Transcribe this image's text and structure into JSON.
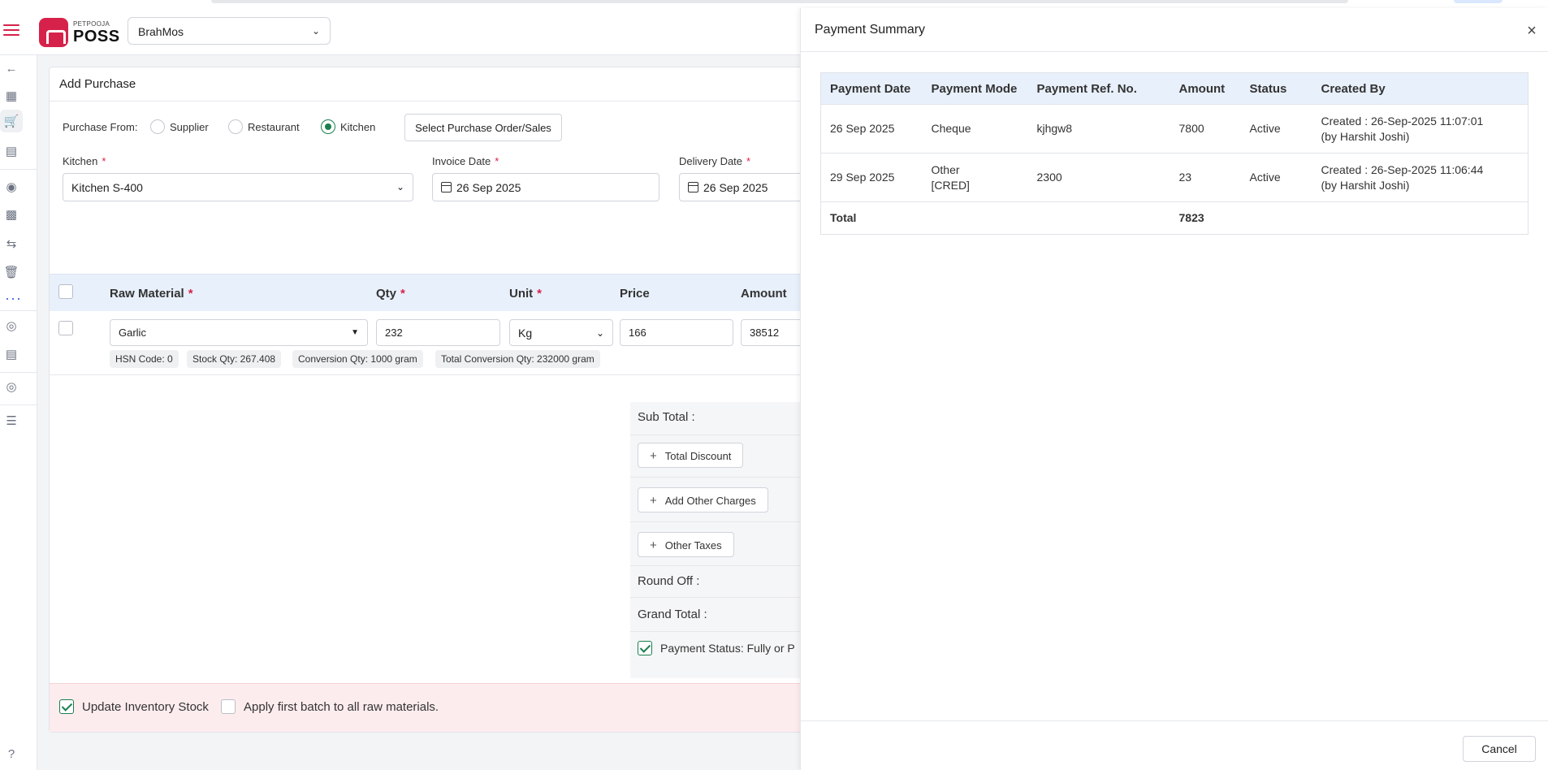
{
  "header": {
    "brand_small": "PETPOOJA",
    "brand_big": "POSS",
    "outlet": "BrahMos"
  },
  "icons": {
    "menu": "hamburger-icon",
    "back": "arrow-left-icon",
    "dropdown": "chevron-down-icon",
    "calendar": "calendar-icon",
    "close": "close-icon",
    "help": "help-icon",
    "more": "more-dots-icon"
  },
  "purchase": {
    "title": "Add Purchase",
    "purchase_from_label": "Purchase From:",
    "options": [
      "Supplier",
      "Restaurant",
      "Kitchen"
    ],
    "selected_option": "Kitchen",
    "select_po_button": "Select Purchase Order/Sales",
    "kitchen_label": "Kitchen",
    "kitchen_value": "Kitchen S-400",
    "invoice_date_label": "Invoice Date",
    "invoice_date_value": "26 Sep 2025",
    "delivery_date_label": "Delivery Date",
    "delivery_date_value": "26 Sep 2025",
    "columns": [
      "Raw Material",
      "Qty",
      "Unit",
      "Price",
      "Amount"
    ],
    "required_mark": "*",
    "row": {
      "raw_material": "Garlic",
      "qty": "232",
      "unit": "Kg",
      "price": "166",
      "amount": "38512"
    },
    "chips": [
      "HSN Code: 0",
      "Stock Qty: 267.408",
      "Conversion Qty: 1000 gram",
      "Total Conversion Qty: 232000 gram"
    ],
    "summary": {
      "sub_total": "Sub Total :",
      "total_discount": "Total Discount",
      "add_other_charges": "Add Other Charges",
      "other_taxes": "Other Taxes",
      "round_off": "Round Off :",
      "grand_total": "Grand Total :",
      "payment_status": "Payment Status: Fully or P",
      "plus": "+"
    },
    "footer": {
      "update_inventory": "Update Inventory Stock",
      "apply_first_batch": "Apply first batch to all raw materials."
    }
  },
  "payment_summary": {
    "title": "Payment Summary",
    "close": "×",
    "columns": [
      "Payment Date",
      "Payment Mode",
      "Payment Ref. No.",
      "Amount",
      "Status",
      "Created By"
    ],
    "rows": [
      {
        "date": "26 Sep 2025",
        "mode_line1": "Cheque",
        "mode_line2": "",
        "ref": "kjhgw8",
        "amount": "7800",
        "status": "Active",
        "created_line1": "Created : 26-Sep-2025 11:07:01",
        "created_line2": "(by Harshit Joshi)"
      },
      {
        "date": "29 Sep 2025",
        "mode_line1": "Other",
        "mode_line2": "[CRED]",
        "ref": "2300",
        "amount": "23",
        "status": "Active",
        "created_line1": "Created : 26-Sep-2025 11:06:44",
        "created_line2": "(by Harshit Joshi)"
      }
    ],
    "total_label": "Total",
    "total_amount": "7823",
    "cancel": "Cancel"
  }
}
